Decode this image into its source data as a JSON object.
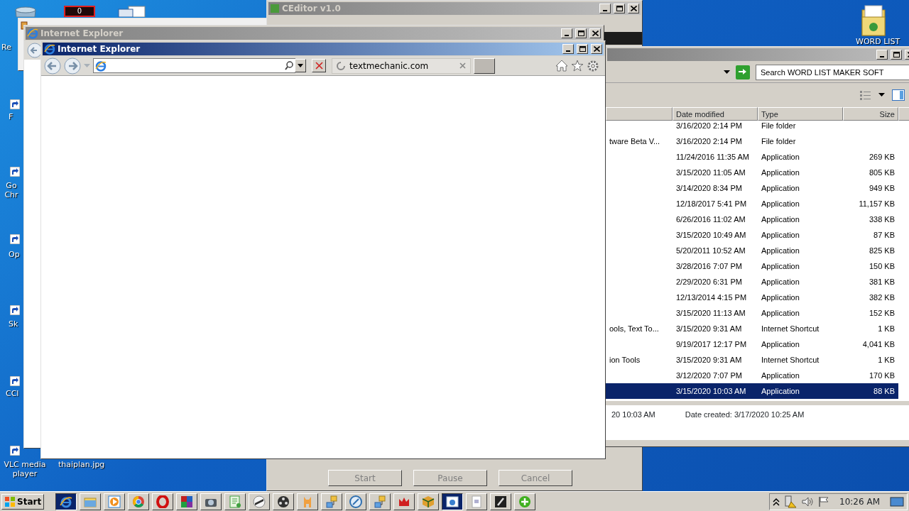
{
  "desktop_icons": [
    {
      "label": "Re",
      "kind": "bin"
    },
    {
      "label": "F",
      "kind": "shortcut"
    },
    {
      "label": "Go Chr",
      "kind": "shortcut"
    },
    {
      "label": "Op",
      "kind": "shortcut"
    },
    {
      "label": "Sk",
      "kind": "shortcut"
    },
    {
      "label": "CCl",
      "kind": "shortcut"
    },
    {
      "label": "VLC media player",
      "kind": "shortcut"
    },
    {
      "label": "thaiplan.jpg",
      "kind": "plain"
    },
    {
      "label": "WORD LIST",
      "kind": "folder"
    }
  ],
  "counter_badge": "0",
  "ceditor": {
    "title": "CEditor v1.0",
    "active": false,
    "buttons": [
      {
        "label": "Start",
        "disabled": true
      },
      {
        "label": "Pause",
        "disabled": true
      },
      {
        "label": "Cancel",
        "disabled": true
      }
    ]
  },
  "explorer": {
    "active": false,
    "search": {
      "placeholder": "Search WORD LIST MAKER SOFT"
    },
    "columns": [
      "Date modified",
      "Type",
      "Size"
    ],
    "rows": [
      {
        "date": "3/16/2020 2:14 PM",
        "type": "File folder",
        "selected": false
      },
      {
        "name": "tware Beta V...",
        "date": "3/16/2020 2:14 PM",
        "type": "File folder",
        "selected": false
      },
      {
        "date": "11/24/2016 11:35 AM",
        "type": "Application",
        "size": "269 KB",
        "selected": false
      },
      {
        "date": "3/15/2020 11:05 AM",
        "type": "Application",
        "size": "805 KB",
        "selected": false
      },
      {
        "date": "3/14/2020 8:34 PM",
        "type": "Application",
        "size": "949 KB",
        "selected": false
      },
      {
        "date": "12/18/2017 5:41 PM",
        "type": "Application",
        "size": "11,157 KB",
        "selected": false
      },
      {
        "date": "6/26/2016 11:02 AM",
        "type": "Application",
        "size": "338 KB",
        "selected": false
      },
      {
        "date": "3/15/2020 10:49 AM",
        "type": "Application",
        "size": "87 KB",
        "selected": false
      },
      {
        "date": "5/20/2011 10:52 AM",
        "type": "Application",
        "size": "825 KB",
        "selected": false
      },
      {
        "date": "3/28/2016 7:07 PM",
        "type": "Application",
        "size": "150 KB",
        "selected": false
      },
      {
        "date": "2/29/2020 6:31 PM",
        "type": "Application",
        "size": "381 KB",
        "selected": false
      },
      {
        "date": "12/13/2014 4:15 PM",
        "type": "Application",
        "size": "382 KB",
        "selected": false
      },
      {
        "date": "3/15/2020 11:13 AM",
        "type": "Application",
        "size": "152 KB",
        "selected": false
      },
      {
        "name": "ools, Text To...",
        "date": "3/15/2020 9:31 AM",
        "type": "Internet Shortcut",
        "size": "1 KB",
        "selected": false
      },
      {
        "date": "9/19/2017 12:17 PM",
        "type": "Application",
        "size": "4,041 KB",
        "selected": false
      },
      {
        "name": "ion Tools",
        "date": "3/15/2020 9:31 AM",
        "type": "Internet Shortcut",
        "size": "1 KB",
        "selected": false
      },
      {
        "date": "3/12/2020 7:07 PM",
        "type": "Application",
        "size": "170 KB",
        "selected": false
      },
      {
        "date": "3/15/2020 10:03 AM",
        "type": "Application",
        "size": "88 KB",
        "selected": true
      }
    ],
    "details": [
      "20 10:03 AM",
      "Date created: 3/17/2020 10:25 AM"
    ]
  },
  "ie_back": {
    "title": "Internet Explorer",
    "active": false
  },
  "ie_front": {
    "title": "Internet Explorer",
    "active": true,
    "tab": {
      "label": "textmechanic.com"
    }
  },
  "taskbar": {
    "start": "Start",
    "buttons": [
      {
        "kind": "browser",
        "selected": true
      },
      {
        "kind": "folder",
        "selected": false
      },
      {
        "kind": "play",
        "selected": false
      },
      {
        "kind": "globe",
        "selected": false
      },
      {
        "kind": "ring",
        "selected": false
      },
      {
        "kind": "grid",
        "selected": false
      },
      {
        "kind": "camera",
        "selected": false
      },
      {
        "kind": "list",
        "selected": false
      },
      {
        "kind": "pen",
        "selected": false
      },
      {
        "kind": "reel",
        "selected": false
      },
      {
        "kind": "figure",
        "selected": false
      },
      {
        "kind": "network",
        "selected": false
      },
      {
        "kind": "compass",
        "selected": false
      },
      {
        "kind": "network",
        "selected": false
      },
      {
        "kind": "crown",
        "selected": false
      },
      {
        "kind": "cube",
        "selected": false
      },
      {
        "kind": "window",
        "selected": true
      },
      {
        "kind": "document",
        "selected": false
      },
      {
        "kind": "pencil",
        "selected": false
      },
      {
        "kind": "plus",
        "selected": false
      }
    ],
    "clock": "10:26 AM"
  }
}
